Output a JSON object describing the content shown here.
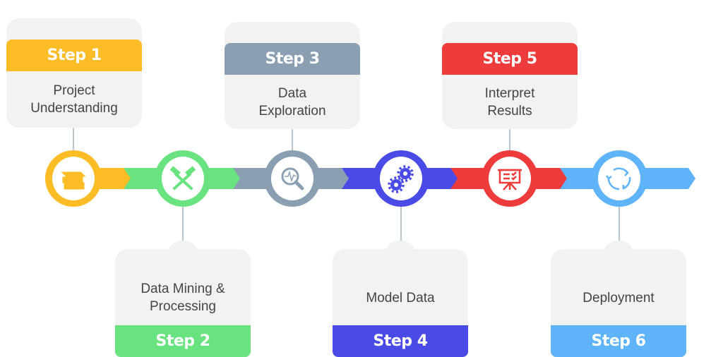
{
  "steps": [
    {
      "step": "Step 1",
      "label": "Project\nUnderstanding",
      "color": "#FBBC25",
      "icon": "books-icon",
      "position": "top"
    },
    {
      "step": "Step 2",
      "label": "Data Mining &\nProcessing",
      "color": "#68E37F",
      "icon": "hammers-icon",
      "position": "bottom"
    },
    {
      "step": "Step 3",
      "label": "Data\nExploration",
      "color": "#8AA0B2",
      "icon": "magnifier-pulse-icon",
      "position": "top"
    },
    {
      "step": "Step 4",
      "label": "Model Data",
      "color": "#4A4BE6",
      "icon": "gears-icon",
      "position": "bottom"
    },
    {
      "step": "Step 5",
      "label": "Interpret\nResults",
      "color": "#EE3B3B",
      "icon": "presentation-board-icon",
      "position": "top"
    },
    {
      "step": "Step 6",
      "label": "Deployment",
      "color": "#5FB3F9",
      "icon": "cycle-arrows-icon",
      "position": "bottom"
    }
  ]
}
